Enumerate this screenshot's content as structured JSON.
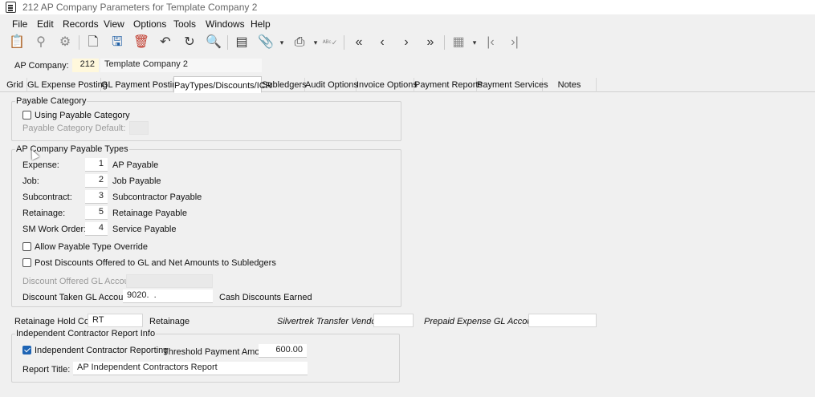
{
  "window": {
    "title": "212 AP Company Parameters for Template Company 2"
  },
  "menu": [
    "File",
    "Edit",
    "Records",
    "View",
    "Options",
    "Tools",
    "Windows",
    "Help"
  ],
  "toolbar_icons": [
    "clipboard-check-icon",
    "binoculars-icon",
    "gear-icon",
    "new-record-icon",
    "save-icon",
    "delete-icon",
    "undo-icon",
    "refresh-icon",
    "search-icon",
    "notes-icon",
    "attachment-icon",
    "print-icon",
    "spellcheck-icon",
    "first-record-icon",
    "previous-record-icon",
    "next-record-icon",
    "last-record-icon",
    "grid-view-icon",
    "first-page-icon",
    "last-page-icon"
  ],
  "header": {
    "company_label": "AP Company:",
    "company_value": "212",
    "company_name": "Template Company 2"
  },
  "tabs": [
    "Grid",
    "GL Expense Posting",
    "GL Payment Posting",
    "PayTypes/Discounts/ICR",
    "Subledgers",
    "Audit Options",
    "Invoice Options",
    "Payment Reports",
    "Payment Services",
    "Notes"
  ],
  "active_tab": "PayTypes/Discounts/ICR",
  "payable_category": {
    "title": "Payable Category",
    "using_label": "Using Payable Category",
    "using_checked": false,
    "default_label": "Payable Category Default:",
    "default_value": ""
  },
  "pay_types": {
    "title": "AP Company Payable Types",
    "rows": [
      {
        "label": "Expense:",
        "value": "1",
        "desc": "AP Payable"
      },
      {
        "label": "Job:",
        "value": "2",
        "desc": "Job Payable"
      },
      {
        "label": "Subcontract:",
        "value": "3",
        "desc": "Subcontractor Payable"
      },
      {
        "label": "Retainage:",
        "value": "5",
        "desc": "Retainage Payable"
      },
      {
        "label": "SM Work Order:",
        "value": "4",
        "desc": "Service Payable"
      }
    ],
    "allow_override_label": "Allow Payable Type Override",
    "allow_override_checked": false,
    "post_discounts_label": "Post Discounts Offered to GL and Net Amounts to Subledgers",
    "post_discounts_checked": false,
    "disc_offered_label": "Discount Offered GL Account:",
    "disc_offered_value": "",
    "disc_taken_label": "Discount Taken GL Account:",
    "disc_taken_value": "9020.  .",
    "disc_taken_desc": "Cash Discounts Earned"
  },
  "retainage": {
    "label": "Retainage Hold Code:",
    "value": "RT",
    "desc": "Retainage",
    "silvertrek_label": "Silvertrek Transfer Vendor:",
    "silvertrek_value": "",
    "prepaid_label": "Prepaid Expense GL Account:",
    "prepaid_value": ""
  },
  "icr": {
    "title": "Independent Contractor Report Info",
    "reporting_label": "Independent Contractor Reporting",
    "reporting_checked": true,
    "threshold_label": "Threshold Payment Amount:",
    "threshold_value": "600.00",
    "report_title_label": "Report Title:",
    "report_title_value": "AP Independent Contractors Report"
  }
}
